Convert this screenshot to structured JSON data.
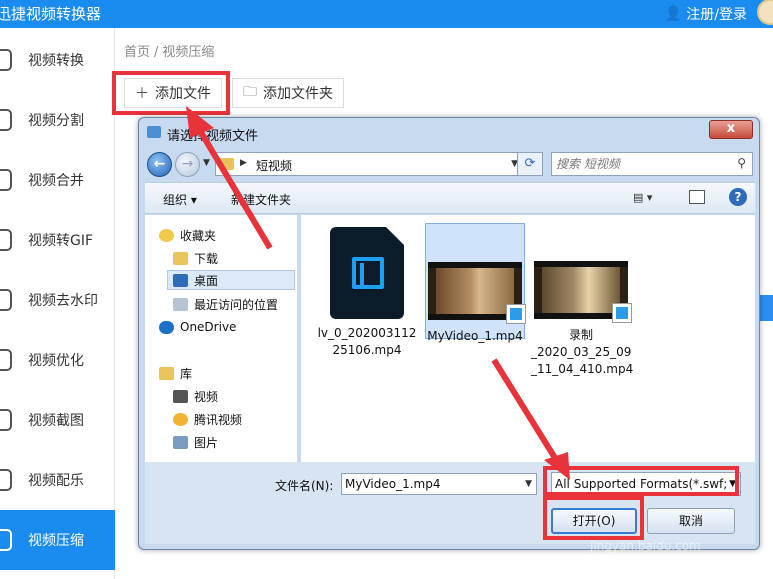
{
  "app": {
    "title": "迅捷视频转换器",
    "login_label": "注册/登录"
  },
  "sidebar": {
    "items": [
      {
        "label": "视频转换"
      },
      {
        "label": "视频分割"
      },
      {
        "label": "视频合并"
      },
      {
        "label": "视频转GIF"
      },
      {
        "label": "视频去水印"
      },
      {
        "label": "视频优化"
      },
      {
        "label": "视频截图"
      },
      {
        "label": "视频配乐"
      },
      {
        "label": "视频压缩"
      }
    ],
    "active": "视频压缩"
  },
  "breadcrumb": {
    "home": "首页",
    "separator": "/",
    "current": "视频压缩"
  },
  "toolbar": {
    "add_file_label": "添加文件",
    "add_folder_label": "添加文件夹"
  },
  "dialog": {
    "title": "请选择视频文件",
    "close_label": "x",
    "address": {
      "path": "短视频",
      "search_placeholder": "搜索 短视频"
    },
    "commands": {
      "organize": "组织 ▾",
      "new_folder": "新建文件夹"
    },
    "nav": {
      "favorites_header": "收藏夹",
      "favorites": [
        "下载",
        "桌面",
        "最近访问的位置"
      ],
      "onedrive": "OneDrive",
      "library_header": "库",
      "library": [
        "视频",
        "腾讯视频",
        "图片"
      ]
    },
    "files": [
      {
        "name": "lv_0_20200311225106.mp4",
        "line1": "lv_0_202003112",
        "line2": "25106.mp4",
        "selected": false,
        "kind": "dark-video-icon"
      },
      {
        "name": "MyVideo_1.mp4",
        "line1": "MyVideo_1.mp4",
        "line2": "",
        "selected": true,
        "kind": "video-thumbnail"
      },
      {
        "name": "录制_2020_03_25_09_11_04_410.mp4",
        "line1": "录制",
        "line2": "_2020_03_25_09",
        "line3": "_11_04_410.mp4",
        "selected": false,
        "kind": "video-thumbnail"
      }
    ],
    "filename_label": "文件名(N):",
    "filename_value": "MyVideo_1.mp4",
    "format_value": "All Supported Formats(*.swf;",
    "open_label": "打开(O)",
    "cancel_label": "取消"
  },
  "watermark": {
    "text": "jingyan.baidu.com"
  },
  "colors": {
    "accent": "#1a8cf0",
    "highlight": "#e8333b"
  }
}
